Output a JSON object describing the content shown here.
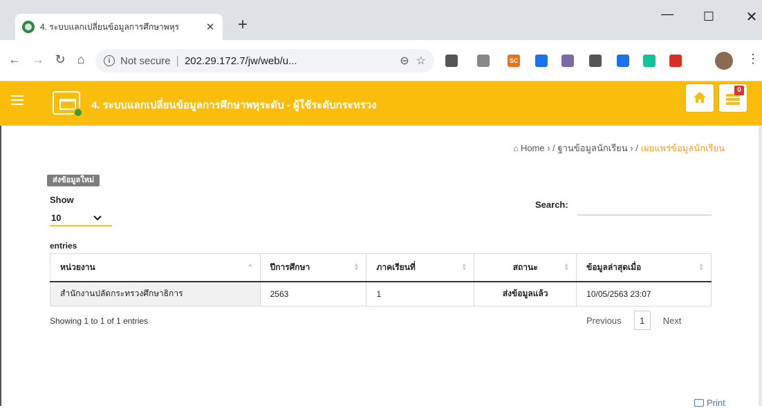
{
  "browser": {
    "tab_title": "4. ระบบแลกเปลี่ยนข้อมูลการศึกษาพหุร",
    "security_label": "Not secure",
    "url": "202.29.172.7/jw/web/u...",
    "extensions": [
      {
        "name": "chat-extension-icon",
        "color": "#555555",
        "label": ""
      },
      {
        "name": "notes-extension-icon",
        "color": "#888888",
        "label": ""
      },
      {
        "name": "sc-extension-icon",
        "color": "#e8711c",
        "label": "SC"
      },
      {
        "name": "o-extension-icon",
        "color": "#1a73e8",
        "label": ""
      },
      {
        "name": "pdf-extension-icon",
        "color": "#7b68a6",
        "label": ""
      },
      {
        "name": "speed-extension-icon",
        "color": "#555555",
        "label": ""
      },
      {
        "name": "cap-extension-icon",
        "color": "#1a73e8",
        "label": ""
      },
      {
        "name": "grammarly-extension-icon",
        "color": "#15c39a",
        "label": ""
      },
      {
        "name": "m-extension-icon",
        "color": "#d93025",
        "label": ""
      }
    ]
  },
  "header": {
    "title": "4. ระบบแลกเปลี่ยนข้อมูลการศึกษาพหุระดับ - ผู้ใช้ระดับกระทรวง",
    "badge_count": "0",
    "accent_color": "#fbbd0b"
  },
  "breadcrumb": {
    "home": "Home",
    "level1": "ฐานข้อมูลนักเรียน",
    "current": "เผยแพร่ข้อมูลนักเรียน"
  },
  "controls": {
    "new_data_button": "ส่งข้อมูลใหม่",
    "show_label": "Show",
    "page_length": "10",
    "entries_label": "entries",
    "search_label": "Search:",
    "search_value": ""
  },
  "table": {
    "columns": [
      "หน่วยงาน",
      "ปีการศึกษา",
      "ภาคเรียนที่",
      "สถานะ",
      "ข้อมูลล่าสุดเมื่อ"
    ],
    "rows": [
      [
        "สำนักงานปลัดกระทรวงศึกษาธิการ",
        "2563",
        "1",
        "ส่งข้อมูลแล้ว",
        "10/05/2563 23:07"
      ]
    ]
  },
  "footer": {
    "info": "Showing 1 to 1 of 1 entries",
    "previous": "Previous",
    "current_page": "1",
    "next": "Next",
    "print": "Print"
  }
}
